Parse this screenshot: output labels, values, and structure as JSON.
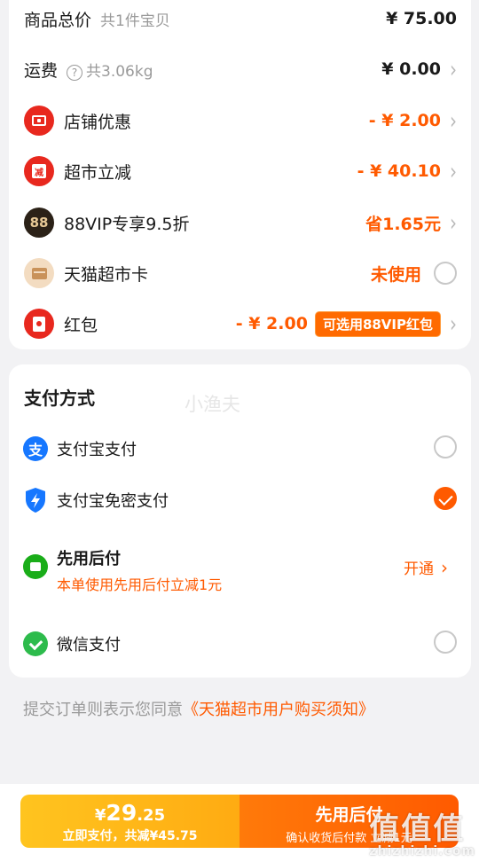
{
  "price_card": {
    "goods_total": {
      "label": "商品总价",
      "sub": "共1件宝贝",
      "value": "¥ 75.00"
    },
    "shipping": {
      "label": "运费",
      "sub": "共3.06kg",
      "value": "¥ 0.00"
    },
    "store_discount": {
      "label": "店铺优惠",
      "value": "- ¥ 2.00"
    },
    "market_reduction": {
      "label": "超市立减",
      "value": "- ¥ 40.10"
    },
    "vip_discount": {
      "label": "88VIP专享9.5折",
      "value": "省1.65元",
      "icon_text": "88"
    },
    "market_card": {
      "label": "天猫超市卡",
      "value": "未使用"
    },
    "red_packet": {
      "label": "红包",
      "value": "- ¥ 2.00",
      "badge": "可选用88VIP红包"
    }
  },
  "payment": {
    "title": "支付方式",
    "watermark": "小渔夫",
    "alipay": {
      "label": "支付宝支付",
      "icon": "alipay-icon"
    },
    "alipay_nopass": {
      "label": "支付宝免密支付",
      "icon": "shield-lightning-icon"
    },
    "pay_later": {
      "label": "先用后付",
      "sub": "本单使用先用后付立减1元",
      "action": "开通"
    },
    "wechat": {
      "label": "微信支付",
      "icon": "wechat-icon"
    }
  },
  "agreement": {
    "prefix": "提交订单则表示您同意",
    "link": "《天猫超市用户购买须知》"
  },
  "bottom": {
    "pay_now": {
      "currency": "¥",
      "amount_int": "29",
      "amount_dec": ".25",
      "desc": "立即支付，共减¥45.75"
    },
    "pay_later": {
      "title": "先用后付",
      "desc": "确认收货后付款 立减1元"
    },
    "corner_mark": "值值值",
    "corner_domain": "zhizhizhi.com"
  },
  "colors": {
    "accent": "#ff5a00",
    "pay_button": "#ffb515",
    "later_button": "#ff6a00"
  }
}
